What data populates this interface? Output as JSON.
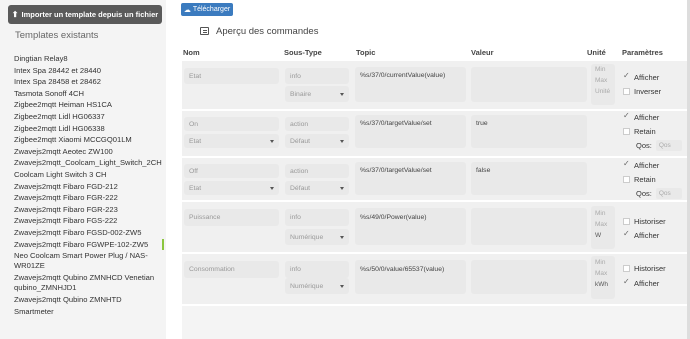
{
  "sidebar": {
    "import_label": "Importer un template depuis un fichier",
    "title": "Templates existants",
    "items": [
      "Dingtian Relay8",
      "Intex Spa 28442 et 28440",
      "Intex Spa 28458 et 28462",
      "Tasmota Sonoff 4CH",
      "Zigbee2mqtt Heiman HS1CA",
      "Zigbee2mqtt Lidl HG06337",
      "Zigbee2mqtt Lidl HG06338",
      "Zigbee2mqtt Xiaomi MCCGQ01LM",
      "Zwavejs2mqtt Aeotec ZW100",
      "Zwavejs2mqtt_Coolcam_Light_Switch_2CH",
      "Coolcam Light Switch 3 CH",
      "Zwavejs2mqtt Fibaro FGD-212",
      "Zwavejs2mqtt Fibaro FGR-222",
      "Zwavejs2mqtt Fibaro FGR-223",
      "Zwavejs2mqtt Fibaro FGS-222",
      "Zwavejs2mqtt Fibaro FGSD-002-ZW5",
      "Zwavejs2mqtt Fibaro FGWPE-102-ZW5",
      "Neo Coolcam Smart Power Plug / NAS-WR01ZE",
      "Zwavejs2mqtt Qubino ZMNHCD Venetian qubino_ZMNHJD1",
      "Zwavejs2mqtt Qubino ZMNHTD",
      "Smartmeter"
    ]
  },
  "main": {
    "download_label": "Télécharger",
    "section_title": "Aperçu des commandes",
    "headers": {
      "nom": "Nom",
      "sous_type": "Sous-Type",
      "topic": "Topic",
      "valeur": "Valeur",
      "unite": "Unité",
      "parametres": "Paramètres"
    },
    "unit_placeholders": {
      "min": "Min",
      "max": "Max",
      "unit": "Unité"
    },
    "param_labels": {
      "afficher": "Afficher",
      "inverser": "Inverser",
      "retain": "Retain",
      "qos": "Qos:",
      "qos_placeholder": "Qos",
      "historiser": "Historiser"
    },
    "commands": [
      {
        "name": "Etat",
        "type": "info",
        "subtype": "Binaire",
        "topic": "%s/37/0/currentValue(value)",
        "value": ""
      },
      {
        "name": "On",
        "generic": "Etat",
        "type": "action",
        "subtype": "Défaut",
        "topic": "%s/37/0/targetValue/set",
        "value": "true"
      },
      {
        "name": "Off",
        "generic": "Etat",
        "type": "action",
        "subtype": "Défaut",
        "topic": "%s/37/0/targetValue/set",
        "value": "false"
      },
      {
        "name": "Puissance",
        "type": "info",
        "subtype": "Numérique",
        "topic": "%s/49/0/Power(value)",
        "value": "",
        "unit": "W"
      },
      {
        "name": "Consommation",
        "type": "info",
        "subtype": "Numérique",
        "topic": "%s/50/0/value/65537(value)",
        "value": "",
        "unit": "kWh"
      }
    ]
  }
}
